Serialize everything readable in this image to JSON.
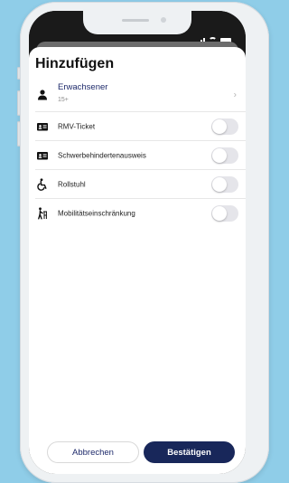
{
  "sheet": {
    "title": "Hinzufügen"
  },
  "passenger": {
    "label": "Erwachsener",
    "age": "15+",
    "icon": "person-icon"
  },
  "options": [
    {
      "label": "RMV-Ticket",
      "icon": "id-card-icon",
      "on": false
    },
    {
      "label": "Schwerbehindertenausweis",
      "icon": "id-card-icon",
      "on": false
    },
    {
      "label": "Rollstuhl",
      "icon": "wheelchair-icon",
      "on": false
    },
    {
      "label": "Mobilitätseinschränkung",
      "icon": "mobility-impaired-icon",
      "on": false
    }
  ],
  "actions": {
    "cancel": "Abbrechen",
    "confirm": "Bestätigen"
  },
  "colors": {
    "background": "#8fcde8",
    "accent": "#18275a",
    "toggle_off": "#e5e5ea"
  }
}
